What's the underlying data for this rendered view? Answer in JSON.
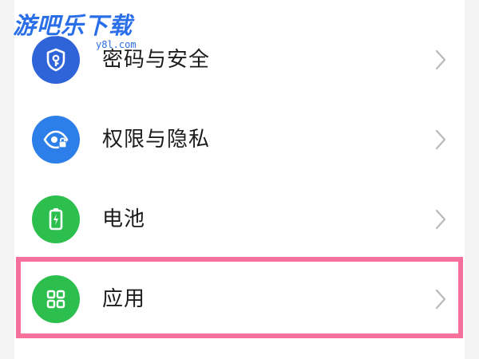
{
  "watermark": {
    "title": "游吧乐下载",
    "url": "y8l.com"
  },
  "settings": {
    "items": [
      {
        "label": "密码与安全",
        "icon": "shield-key-icon",
        "icon_bg": "#2f63d8"
      },
      {
        "label": "权限与隐私",
        "icon": "eye-lock-icon",
        "icon_bg": "#2c7fe8"
      },
      {
        "label": "电池",
        "icon": "battery-charging-icon",
        "icon_bg": "#2dbf4e"
      },
      {
        "label": "应用",
        "icon": "apps-grid-icon",
        "icon_bg": "#2dbf4e"
      }
    ]
  },
  "colors": {
    "highlight": "#f5709a",
    "chevron": "#b9b9b9",
    "text": "#1c1c1c"
  }
}
